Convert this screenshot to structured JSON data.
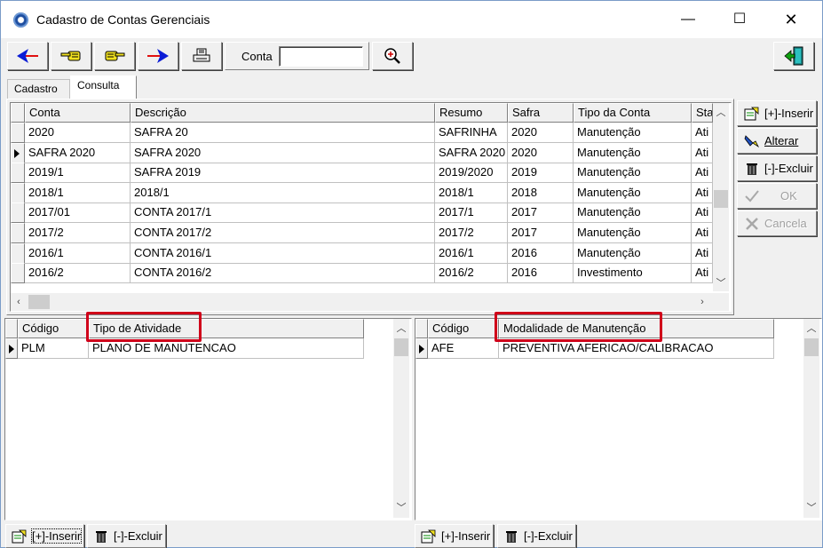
{
  "window": {
    "title": "Cadastro de Contas Gerenciais",
    "min_glyph": "—",
    "max_glyph": "☐",
    "close_glyph": "✕"
  },
  "toolbar": {
    "buttons": [
      {
        "name": "first-record-button",
        "icon": "arrow-left-icon"
      },
      {
        "name": "previous-record-button",
        "icon": "hand-left-icon"
      },
      {
        "name": "next-record-button",
        "icon": "hand-right-icon"
      },
      {
        "name": "last-record-button",
        "icon": "arrow-right-icon"
      },
      {
        "name": "print-button",
        "icon": "printer-icon"
      },
      {
        "name": "search-button",
        "icon": "magnifier-icon"
      },
      {
        "name": "exit-button",
        "icon": "exit-door-icon"
      }
    ],
    "conta_label": "Conta",
    "conta_value": ""
  },
  "tabs": [
    {
      "label": "Cadastro",
      "active": false
    },
    {
      "label": "Consulta",
      "active": true
    }
  ],
  "main_grid": {
    "columns": [
      "Conta",
      "Descrição",
      "Resumo",
      "Safra",
      "Tipo da Conta",
      "Sta"
    ],
    "rows": [
      [
        "2020",
        "SAFRA 20",
        "SAFRINHA",
        "2020",
        "Manutenção",
        "Ati"
      ],
      [
        "SAFRA 2020",
        "SAFRA 2020",
        "SAFRA 2020",
        "2020",
        "Manutenção",
        "Ati"
      ],
      [
        "2019/1",
        "SAFRA 2019",
        "2019/2020",
        "2019",
        "Manutenção",
        "Ati"
      ],
      [
        "2018/1",
        "2018/1",
        "2018/1",
        "2018",
        "Manutenção",
        "Ati"
      ],
      [
        "2017/01",
        "CONTA 2017/1",
        "2017/1",
        "2017",
        "Manutenção",
        "Ati"
      ],
      [
        "2017/2",
        "CONTA 2017/2",
        "2017/2",
        "2017",
        "Manutenção",
        "Ati"
      ],
      [
        "2016/1",
        "CONTA 2016/1",
        "2016/1",
        "2016",
        "Manutenção",
        "Ati"
      ],
      [
        "2016/2",
        "CONTA 2016/2",
        "2016/2",
        "2016",
        "Investimento",
        "Ati"
      ]
    ],
    "selected_row": 1
  },
  "side_buttons": [
    {
      "label": "[+]-Inserir",
      "icon": "insert-icon",
      "enabled": true
    },
    {
      "label": "Alterar",
      "icon": "edit-icon",
      "enabled": true
    },
    {
      "label": "[-]-Excluir",
      "icon": "trash-icon",
      "enabled": true
    },
    {
      "label": "OK",
      "icon": "check-icon",
      "enabled": false
    },
    {
      "label": "Cancela",
      "icon": "cancel-icon",
      "enabled": false
    }
  ],
  "activity_grid": {
    "columns": [
      "Código",
      "Tipo de Atividade"
    ],
    "rows": [
      [
        "PLM",
        "PLANO DE MANUTENCAO"
      ]
    ]
  },
  "modality_grid": {
    "columns": [
      "Código",
      "Modalidade de Manutenção"
    ],
    "rows": [
      [
        "AFE",
        "PREVENTIVA AFERICAO/CALIBRACAO"
      ]
    ]
  },
  "bottom_buttons": {
    "left_insert": "[+]-Inserir",
    "left_delete": "[-]-Excluir",
    "right_insert": "[+]-Inserir",
    "right_delete": "[-]-Excluir"
  },
  "colors": {
    "highlight": "#d0001a",
    "window_bg": "#f0f0f0"
  }
}
